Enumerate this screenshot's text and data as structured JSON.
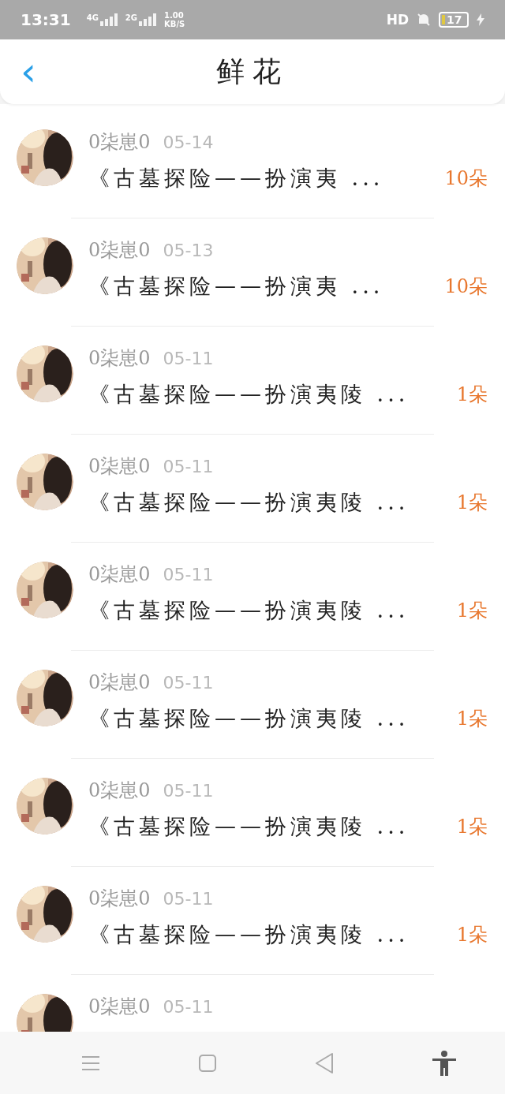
{
  "status_bar": {
    "time": "13:31",
    "network_1": "4G",
    "network_2": "2G",
    "speed": "1.00",
    "speed_unit": "KB/S",
    "hd": "HD",
    "battery": "17"
  },
  "header": {
    "back": "‹",
    "title": "鲜花"
  },
  "rows": [
    {
      "name": "0柒崽0",
      "date": "05-14",
      "title": "《古墓探险——扮演夷 ...",
      "count": "10朵"
    },
    {
      "name": "0柒崽0",
      "date": "05-13",
      "title": "《古墓探险——扮演夷 ...",
      "count": "10朵"
    },
    {
      "name": "0柒崽0",
      "date": "05-11",
      "title": "《古墓探险——扮演夷陵 ...",
      "count": "1朵"
    },
    {
      "name": "0柒崽0",
      "date": "05-11",
      "title": "《古墓探险——扮演夷陵 ...",
      "count": "1朵"
    },
    {
      "name": "0柒崽0",
      "date": "05-11",
      "title": "《古墓探险——扮演夷陵 ...",
      "count": "1朵"
    },
    {
      "name": "0柒崽0",
      "date": "05-11",
      "title": "《古墓探险——扮演夷陵 ...",
      "count": "1朵"
    },
    {
      "name": "0柒崽0",
      "date": "05-11",
      "title": "《古墓探险——扮演夷陵 ...",
      "count": "1朵"
    },
    {
      "name": "0柒崽0",
      "date": "05-11",
      "title": "《古墓探险——扮演夷陵 ...",
      "count": "1朵"
    },
    {
      "name": "0柒崽0",
      "date": "05-11"
    }
  ]
}
